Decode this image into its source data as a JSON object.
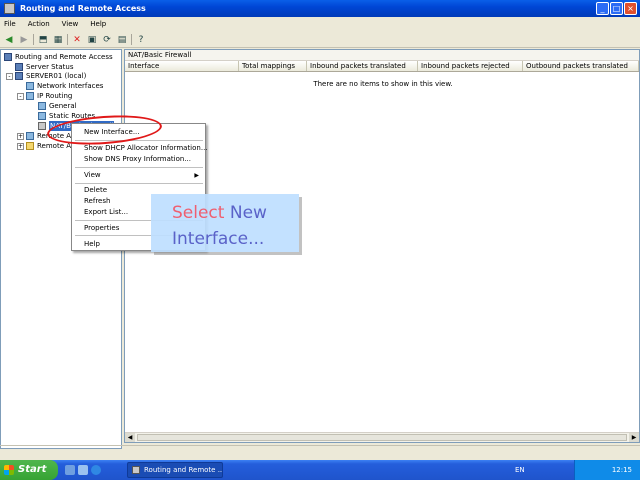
{
  "window": {
    "title": "Routing and Remote Access"
  },
  "menu": {
    "items": [
      "File",
      "Action",
      "View",
      "Help"
    ]
  },
  "toolbar": {
    "icons": [
      "back-icon",
      "forward-icon",
      "up-icon",
      "show-hide-tree-icon",
      "delete-icon",
      "properties-icon",
      "refresh-icon",
      "export-icon",
      "help-icon"
    ]
  },
  "tree": {
    "root": "Routing and Remote Access",
    "server_status": "Server Status",
    "server": "SERVER01 (local)",
    "network_interfaces": "Network Interfaces",
    "ip_routing": "IP Routing",
    "general": "General",
    "static_routes": "Static Routes",
    "nat": "NAT/Basic Firewall",
    "remote_access_policies": "Remote Access Policies",
    "remote_access_logging": "Remote Access Logging"
  },
  "panel": {
    "title": "NAT/Basic Firewall",
    "columns": [
      "Interface",
      "Total mappings",
      "Inbound packets translated",
      "Inbound packets rejected",
      "Outbound packets translated"
    ],
    "empty_message": "There are no items to show in this view."
  },
  "context_menu": {
    "new_interface": "New Interface...",
    "show_dhcp": "Show DHCP Allocator Information...",
    "show_dns": "Show DNS Proxy Information...",
    "view": "View",
    "delete": "Delete",
    "refresh": "Refresh",
    "export": "Export List...",
    "properties": "Properties",
    "help": "Help"
  },
  "callout": {
    "word1": "Select",
    "word2": "New",
    "word3": "Interface..."
  },
  "taskbar": {
    "start": "Start",
    "task": "Routing and Remote ...",
    "language": "EN",
    "clock": "12:15"
  },
  "colors": {
    "titlebar": "#0046d5",
    "highlight_circle": "#e01818",
    "callout_bg": "#bedeff",
    "callout_word1": "#ef5f70",
    "callout_word2": "#5a62c8"
  }
}
